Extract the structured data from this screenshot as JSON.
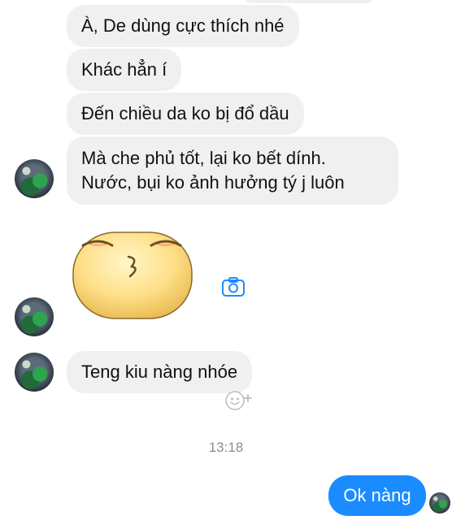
{
  "conversation": {
    "incoming_messages": [
      "À, De dùng cực thích nhé",
      "Khác hẳn í",
      "Đến chiều da ko bị đổ dầu",
      "Mà che phủ tốt, lại ko bết dính.",
      "Nước, bụi ko ảnh hưởng tý j luôn",
      "Teng kiu nàng nhóe"
    ],
    "sticker_icon": "kissing-face-sticker",
    "timestamp": "13:18",
    "outgoing_message": "Ok nàng"
  },
  "icons": {
    "camera": "camera-icon",
    "reaction": "add-reaction-icon"
  },
  "colors": {
    "incoming_bubble": "#f1f0f0",
    "outgoing_bubble": "#1a8cff",
    "accent": "#1a8cff",
    "timestamp": "#8a8d91"
  }
}
